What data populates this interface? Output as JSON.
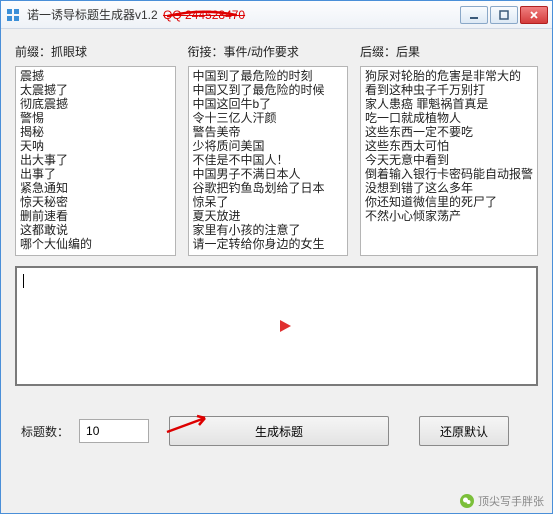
{
  "window": {
    "title": "诺一诱导标题生成器v1.2",
    "qq_text": "QQ 244528470"
  },
  "columns": {
    "prefix": {
      "label": "前缀：抓眼球",
      "items": [
        "震撼",
        "太震撼了",
        "彻底震撼",
        "警惕",
        "揭秘",
        "天呐",
        "出大事了",
        "出事了",
        "紧急通知",
        "惊天秘密",
        "删前速看",
        "这都敢说",
        "哪个大仙编的"
      ]
    },
    "middle": {
      "label": "衔接：事件/动作要求",
      "items": [
        "中国到了最危险的时刻",
        "中国又到了最危险的时候",
        "中国这回牛b了",
        "令十三亿人汗颜",
        "警告美帝",
        "少将质问美国",
        "不佳是不中国人！",
        "中国男子不满日本人",
        "谷歌把钓鱼岛划给了日本",
        "惊呆了",
        "夏天放进",
        "家里有小孩的注意了",
        "请一定转给你身边的女生"
      ]
    },
    "suffix": {
      "label": "后缀：后果",
      "items": [
        "狗尿对轮胎的危害是非常大的",
        "看到这种虫子千万别打",
        "家人患癌 罪魁祸首真是",
        "吃一口就成植物人",
        "这些东西一定不要吃",
        "这些东西太可怕",
        "今天无意中看到",
        "倒着输入银行卡密码能自动报警",
        "没想到错了这么多年",
        "你还知道微信里的死尸了",
        "不然小心倾家荡产"
      ]
    }
  },
  "output": {
    "value": ""
  },
  "controls": {
    "count_label": "标题数：",
    "count_value": "10",
    "generate_label": "生成标题",
    "reset_label": "还原默认"
  },
  "watermark": {
    "text": "顶尖写手胖张"
  }
}
